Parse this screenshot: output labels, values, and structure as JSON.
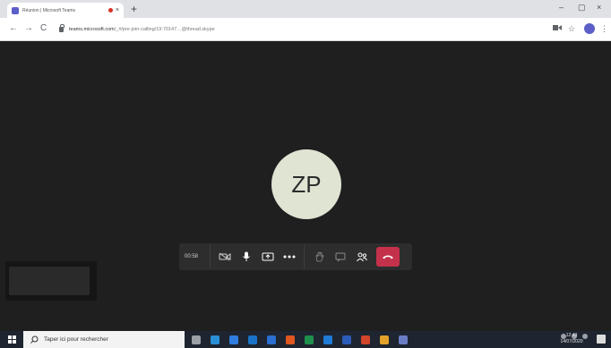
{
  "browser": {
    "tab_title": "Réunion | Microsoft Teams",
    "tab_close": "×",
    "new_tab": "+",
    "window_minimize": "–",
    "window_restore": "▢",
    "window_close": "×",
    "url_host": "teams.microsoft.com",
    "url_path": "/_#/pre-join-calling/19:70147…@thread.skype",
    "back": "←",
    "forward": "→",
    "reload": "C"
  },
  "meeting": {
    "avatar_initials": "ZP",
    "timer": "00:58",
    "controls": [
      {
        "icon": "video-off-icon"
      },
      {
        "icon": "microphone-icon"
      },
      {
        "icon": "share-screen-icon"
      },
      {
        "icon": "more-options-icon"
      },
      {
        "icon": "raise-hand-icon"
      },
      {
        "icon": "chat-icon"
      },
      {
        "icon": "participants-icon"
      },
      {
        "icon": "hang-up-icon"
      }
    ],
    "hangup_color": "#c4314b"
  },
  "taskbar": {
    "search_placeholder": "Taper ici pour rechercher",
    "clock_time": "12:43",
    "clock_date": "14/07/2020",
    "apps": [
      {
        "icon": "task-view-icon",
        "color": "#9aa0a6"
      },
      {
        "icon": "edge-icon",
        "color": "#2b8fd6"
      },
      {
        "icon": "store-icon",
        "color": "#2f7de1"
      },
      {
        "icon": "outlook-icon",
        "color": "#1a73c8"
      },
      {
        "icon": "mail-icon",
        "color": "#2a6fd1"
      },
      {
        "icon": "office-icon",
        "color": "#e0561f"
      },
      {
        "icon": "excel-icon",
        "color": "#1f8f4e"
      },
      {
        "icon": "outlook-icon",
        "color": "#1f7bd6"
      },
      {
        "icon": "word-icon",
        "color": "#2b5cba"
      },
      {
        "icon": "powerpoint-icon",
        "color": "#d2452b"
      },
      {
        "icon": "chrome-icon",
        "color": "#e3a22a"
      },
      {
        "icon": "app-icon",
        "color": "#6a7dc4"
      }
    ]
  }
}
